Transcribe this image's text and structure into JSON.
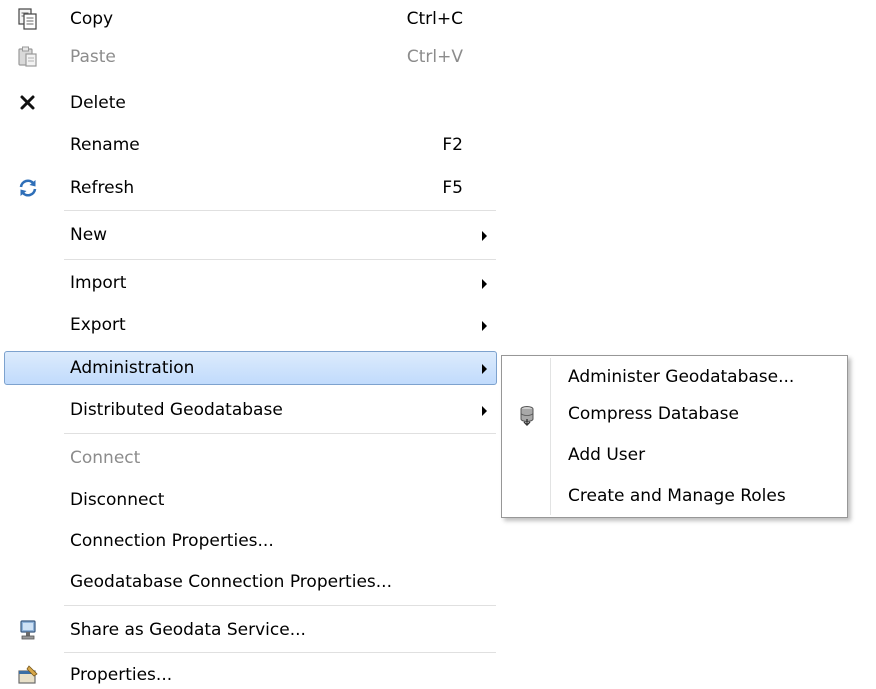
{
  "context_menu": {
    "items": [
      {
        "label": "Copy",
        "shortcut": "Ctrl+C",
        "icon": "copy-icon"
      },
      {
        "label": "Paste",
        "shortcut": "Ctrl+V",
        "icon": "paste-icon",
        "disabled": true
      },
      {
        "label": "Delete",
        "shortcut": "",
        "icon": "delete-icon"
      },
      {
        "label": "Rename",
        "shortcut": "F2"
      },
      {
        "label": "Refresh",
        "shortcut": "F5",
        "icon": "refresh-icon"
      },
      {
        "label": "New",
        "submenu": true
      },
      {
        "label": "Import",
        "submenu": true
      },
      {
        "label": "Export",
        "submenu": true
      },
      {
        "label": "Administration",
        "submenu": true,
        "selected": true
      },
      {
        "label": "Distributed Geodatabase",
        "submenu": true
      },
      {
        "label": "Connect",
        "disabled": true
      },
      {
        "label": "Disconnect"
      },
      {
        "label": "Connection Properties..."
      },
      {
        "label": "Geodatabase Connection Properties..."
      },
      {
        "label": "Share as Geodata Service...",
        "icon": "geodata-service-icon"
      },
      {
        "label": "Properties...",
        "icon": "properties-icon"
      }
    ]
  },
  "administration_submenu": {
    "items": [
      {
        "label": "Administer Geodatabase..."
      },
      {
        "label": "Compress Database",
        "icon": "compress-database-icon"
      },
      {
        "label": "Add User"
      },
      {
        "label": "Create and Manage Roles"
      }
    ]
  },
  "colors": {
    "selection_border": "#7da2ce",
    "selection_fill": "#c1dbfc",
    "disabled_text": "#8c8c8c"
  }
}
